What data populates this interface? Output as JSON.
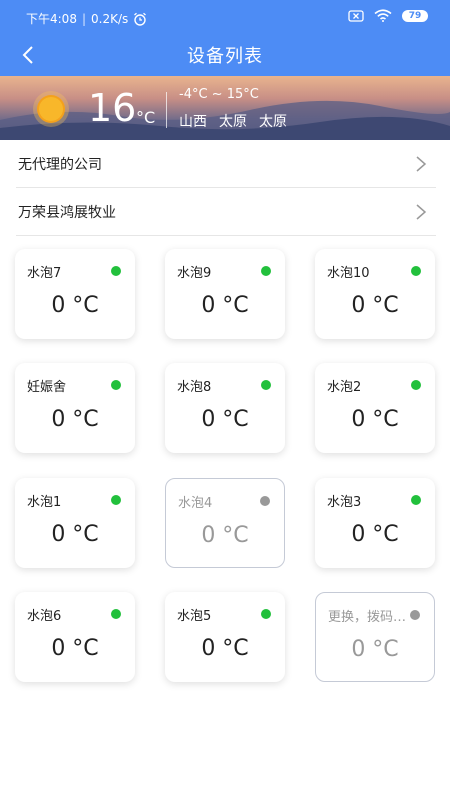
{
  "status_bar": {
    "time": "下午4:08",
    "speed": "0.2K/s",
    "battery": "79"
  },
  "nav": {
    "title": "设备列表"
  },
  "weather": {
    "temp": "16",
    "unit": "°C",
    "range": "-4°C ~ 15°C",
    "location": [
      "山西",
      "太原",
      "太原"
    ]
  },
  "companies": [
    {
      "label": "无代理的公司"
    },
    {
      "label": "万荣县鸿展牧业"
    }
  ],
  "colors": {
    "accent": "#4d8cf5",
    "online": "#22c03c",
    "offline": "#999999"
  },
  "devices": [
    {
      "name": "水泡7",
      "temp": "0 °C",
      "status": "online"
    },
    {
      "name": "水泡9",
      "temp": "0 °C",
      "status": "online"
    },
    {
      "name": "水泡10",
      "temp": "0 °C",
      "status": "online"
    },
    {
      "name": "妊娠舍",
      "temp": "0 °C",
      "status": "online"
    },
    {
      "name": "水泡8",
      "temp": "0 °C",
      "status": "online"
    },
    {
      "name": "水泡2",
      "temp": "0 °C",
      "status": "online"
    },
    {
      "name": "水泡1",
      "temp": "0 °C",
      "status": "online"
    },
    {
      "name": "水泡4",
      "temp": "0 °C",
      "status": "offline"
    },
    {
      "name": "水泡3",
      "temp": "0 °C",
      "status": "online"
    },
    {
      "name": "水泡6",
      "temp": "0 °C",
      "status": "online"
    },
    {
      "name": "水泡5",
      "temp": "0 °C",
      "status": "online"
    },
    {
      "name": "更换，拨码一…",
      "temp": "0 °C",
      "status": "offline"
    }
  ]
}
